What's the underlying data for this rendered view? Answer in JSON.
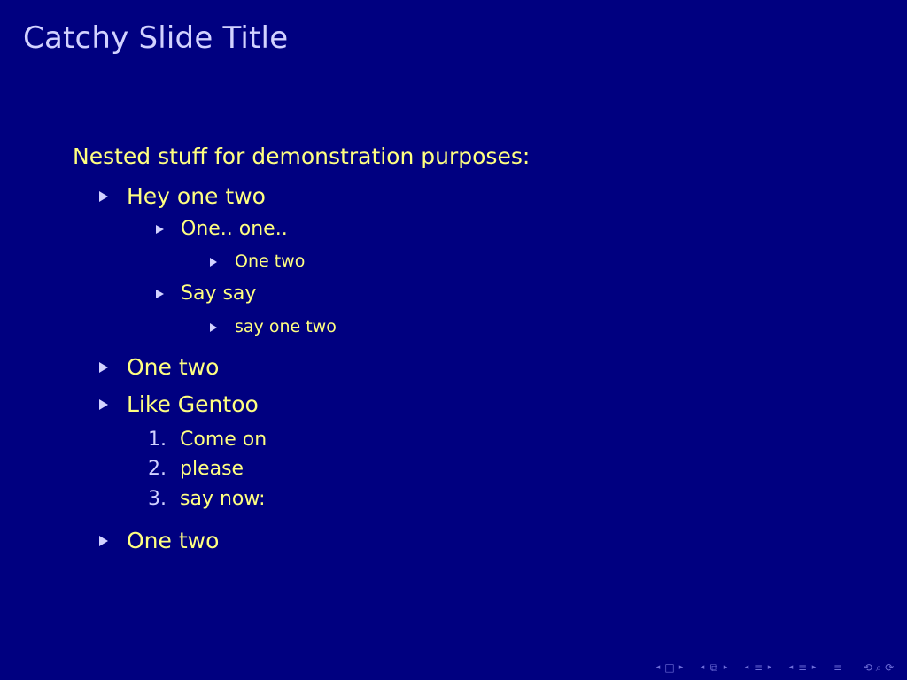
{
  "slide": {
    "title": "Catchy Slide Title",
    "intro": "Nested stuff for demonstration purposes:"
  },
  "list": {
    "item1": "Hey one two",
    "item1_sub1": "One.. one..",
    "item1_sub1_sub1": "One two",
    "item1_sub2": "Say say",
    "item1_sub2_sub1": "say one two",
    "item2": "One two",
    "item3": "Like Gentoo",
    "enum": [
      {
        "num": "1.",
        "text": "Come on"
      },
      {
        "num": "2.",
        "text": "please"
      },
      {
        "num": "3.",
        "text": "say now:"
      }
    ],
    "item4": "One two"
  },
  "nav_icons": {
    "left": "◂",
    "right": "▸",
    "frame": "□",
    "subsection": "⧉",
    "section": "≡",
    "document": "≡",
    "search": "⟲ ⌕ ⟳"
  },
  "colors": {
    "background": "#000080",
    "text": "#ffff80",
    "title": "#d2d2ff",
    "bullet": "#d2d2ff",
    "nav": "#6e6ed8"
  }
}
